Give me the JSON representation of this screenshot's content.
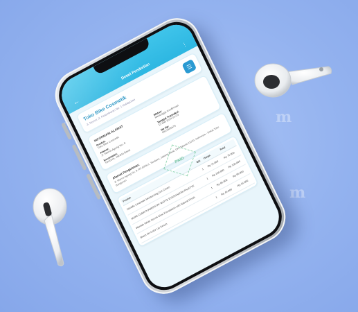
{
  "appbar": {
    "title": "Detail Pembelian",
    "back_icon": "arrow-left-icon",
    "menu_icon": "more-icon"
  },
  "store": {
    "name": "Toko Bike Cosmetik",
    "subtitle": "Jl. Nomor Jl. Petamburan No. 1 Kebayoran"
  },
  "info": {
    "title": "INFORMASI ALAMAT",
    "rows": [
      {
        "label": "Produk:",
        "value": "Toko Bike Cosmetik"
      },
      {
        "label": "Status:",
        "value": "Menunggu Konfirmasi"
      },
      {
        "label": "Alamat:",
        "value": "Jl. Warna Agung No. 8"
      },
      {
        "label": "Tanggal Transaksi:",
        "value": "13 Mei 2024 01:23"
      },
      {
        "label": "Kecamatan:",
        "value": "Tambora, Jakarta Barat"
      },
      {
        "label": "No Hp:",
        "value": "0812345678"
      }
    ]
  },
  "address": {
    "title": "Alamat Pengiriman:",
    "text": "Jl. Warna Agung No. 8, RT.4/RW.1, Tambora, Jakarta Barat, DKI Jakarta 11210, Indonesia - Dekat Toko Bangunan"
  },
  "stamp": {
    "text": "PAID"
  },
  "table": {
    "headers": [
      "Produk",
      "Qty",
      "Harga",
      "Total"
    ],
    "rows": [
      {
        "product": "Skintific Ceramide Moisturizing Gel Cream",
        "qty": "1",
        "price": "Rp 75.000",
        "total": "Rp 75.000"
      },
      {
        "product": "MAKE OVER POWERSTAY MATTE EYESHADOW PALETTE",
        "qty": "1",
        "price": "Rp 130.000",
        "total": "Rp 130.000"
      },
      {
        "product": "Wardah White Secret Glow Foundation with Natural Finish",
        "qty": "1",
        "price": "Rp 85.000",
        "total": "Rp 85.000"
      },
      {
        "product": "Blush On Color Lip Serum",
        "qty": "1",
        "price": "Rp 45.000",
        "total": "Rp 45.000"
      }
    ]
  },
  "watermarks": [
    "m",
    "m",
    "m",
    "m"
  ]
}
